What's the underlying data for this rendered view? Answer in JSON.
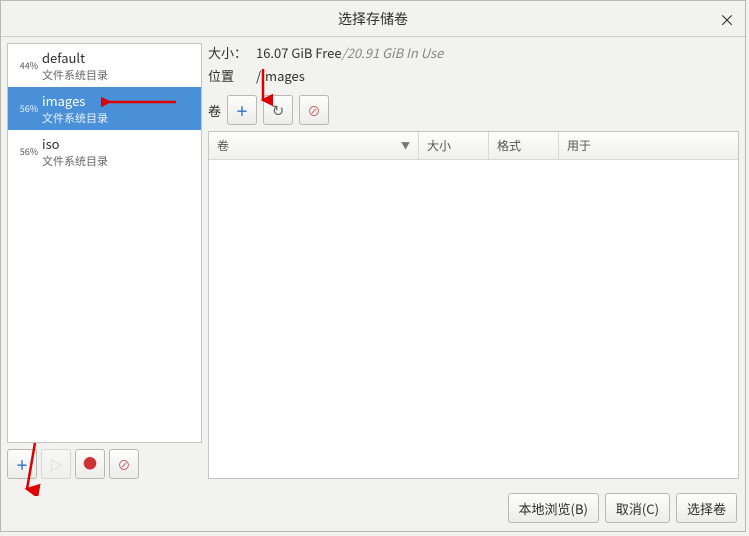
{
  "title": "选择存储卷",
  "close_symbol": "×",
  "pools": [
    {
      "pct": "44%",
      "name": "default",
      "sub": "文件系统目录",
      "selected": false
    },
    {
      "pct": "56%",
      "name": "images",
      "sub": "文件系统目录",
      "selected": true
    },
    {
      "pct": "56%",
      "name": "iso",
      "sub": "文件系统目录",
      "selected": false
    }
  ],
  "info": {
    "size_label": "大小：",
    "free": "16.07 GiB Free",
    "sep": " / ",
    "inuse": "20.91 GiB In Use",
    "loc_label": "位置",
    "loc_value": "/images"
  },
  "vol_label": "卷",
  "vol_headers": {
    "name": "卷",
    "size": "大小",
    "format": "格式",
    "used": "用于"
  },
  "footer": {
    "browse": "本地浏览(B)",
    "cancel": "取消(C)",
    "choose": "选择卷"
  },
  "icons": {
    "plus": "＋",
    "play": "▷",
    "record": "●",
    "stop": "⊘",
    "refresh": "↻"
  }
}
